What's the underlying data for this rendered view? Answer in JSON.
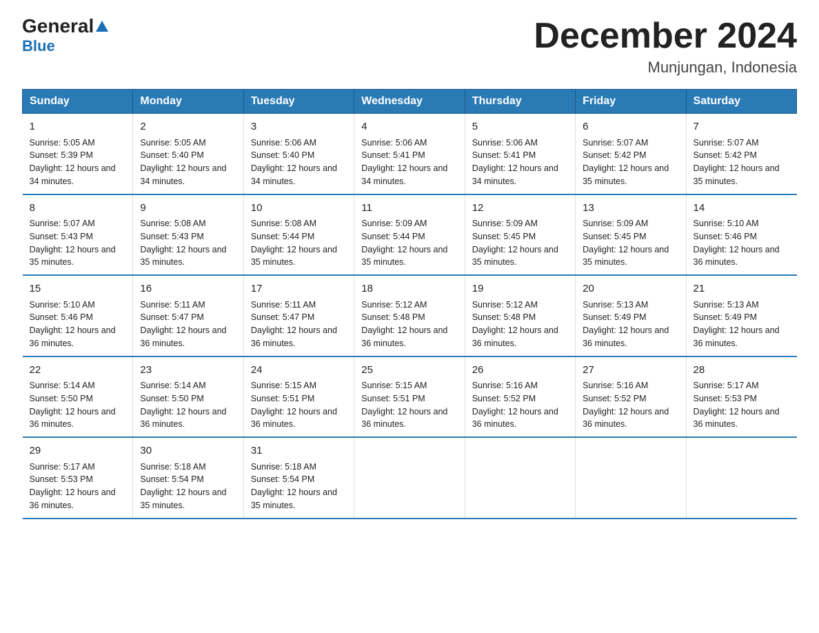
{
  "header": {
    "logo_general": "General",
    "logo_blue": "Blue",
    "title": "December 2024",
    "subtitle": "Munjungan, Indonesia"
  },
  "columns": [
    "Sunday",
    "Monday",
    "Tuesday",
    "Wednesday",
    "Thursday",
    "Friday",
    "Saturday"
  ],
  "weeks": [
    [
      {
        "day": "1",
        "sunrise": "5:05 AM",
        "sunset": "5:39 PM",
        "daylight": "12 hours and 34 minutes."
      },
      {
        "day": "2",
        "sunrise": "5:05 AM",
        "sunset": "5:40 PM",
        "daylight": "12 hours and 34 minutes."
      },
      {
        "day": "3",
        "sunrise": "5:06 AM",
        "sunset": "5:40 PM",
        "daylight": "12 hours and 34 minutes."
      },
      {
        "day": "4",
        "sunrise": "5:06 AM",
        "sunset": "5:41 PM",
        "daylight": "12 hours and 34 minutes."
      },
      {
        "day": "5",
        "sunrise": "5:06 AM",
        "sunset": "5:41 PM",
        "daylight": "12 hours and 34 minutes."
      },
      {
        "day": "6",
        "sunrise": "5:07 AM",
        "sunset": "5:42 PM",
        "daylight": "12 hours and 35 minutes."
      },
      {
        "day": "7",
        "sunrise": "5:07 AM",
        "sunset": "5:42 PM",
        "daylight": "12 hours and 35 minutes."
      }
    ],
    [
      {
        "day": "8",
        "sunrise": "5:07 AM",
        "sunset": "5:43 PM",
        "daylight": "12 hours and 35 minutes."
      },
      {
        "day": "9",
        "sunrise": "5:08 AM",
        "sunset": "5:43 PM",
        "daylight": "12 hours and 35 minutes."
      },
      {
        "day": "10",
        "sunrise": "5:08 AM",
        "sunset": "5:44 PM",
        "daylight": "12 hours and 35 minutes."
      },
      {
        "day": "11",
        "sunrise": "5:09 AM",
        "sunset": "5:44 PM",
        "daylight": "12 hours and 35 minutes."
      },
      {
        "day": "12",
        "sunrise": "5:09 AM",
        "sunset": "5:45 PM",
        "daylight": "12 hours and 35 minutes."
      },
      {
        "day": "13",
        "sunrise": "5:09 AM",
        "sunset": "5:45 PM",
        "daylight": "12 hours and 35 minutes."
      },
      {
        "day": "14",
        "sunrise": "5:10 AM",
        "sunset": "5:46 PM",
        "daylight": "12 hours and 36 minutes."
      }
    ],
    [
      {
        "day": "15",
        "sunrise": "5:10 AM",
        "sunset": "5:46 PM",
        "daylight": "12 hours and 36 minutes."
      },
      {
        "day": "16",
        "sunrise": "5:11 AM",
        "sunset": "5:47 PM",
        "daylight": "12 hours and 36 minutes."
      },
      {
        "day": "17",
        "sunrise": "5:11 AM",
        "sunset": "5:47 PM",
        "daylight": "12 hours and 36 minutes."
      },
      {
        "day": "18",
        "sunrise": "5:12 AM",
        "sunset": "5:48 PM",
        "daylight": "12 hours and 36 minutes."
      },
      {
        "day": "19",
        "sunrise": "5:12 AM",
        "sunset": "5:48 PM",
        "daylight": "12 hours and 36 minutes."
      },
      {
        "day": "20",
        "sunrise": "5:13 AM",
        "sunset": "5:49 PM",
        "daylight": "12 hours and 36 minutes."
      },
      {
        "day": "21",
        "sunrise": "5:13 AM",
        "sunset": "5:49 PM",
        "daylight": "12 hours and 36 minutes."
      }
    ],
    [
      {
        "day": "22",
        "sunrise": "5:14 AM",
        "sunset": "5:50 PM",
        "daylight": "12 hours and 36 minutes."
      },
      {
        "day": "23",
        "sunrise": "5:14 AM",
        "sunset": "5:50 PM",
        "daylight": "12 hours and 36 minutes."
      },
      {
        "day": "24",
        "sunrise": "5:15 AM",
        "sunset": "5:51 PM",
        "daylight": "12 hours and 36 minutes."
      },
      {
        "day": "25",
        "sunrise": "5:15 AM",
        "sunset": "5:51 PM",
        "daylight": "12 hours and 36 minutes."
      },
      {
        "day": "26",
        "sunrise": "5:16 AM",
        "sunset": "5:52 PM",
        "daylight": "12 hours and 36 minutes."
      },
      {
        "day": "27",
        "sunrise": "5:16 AM",
        "sunset": "5:52 PM",
        "daylight": "12 hours and 36 minutes."
      },
      {
        "day": "28",
        "sunrise": "5:17 AM",
        "sunset": "5:53 PM",
        "daylight": "12 hours and 36 minutes."
      }
    ],
    [
      {
        "day": "29",
        "sunrise": "5:17 AM",
        "sunset": "5:53 PM",
        "daylight": "12 hours and 36 minutes."
      },
      {
        "day": "30",
        "sunrise": "5:18 AM",
        "sunset": "5:54 PM",
        "daylight": "12 hours and 35 minutes."
      },
      {
        "day": "31",
        "sunrise": "5:18 AM",
        "sunset": "5:54 PM",
        "daylight": "12 hours and 35 minutes."
      },
      null,
      null,
      null,
      null
    ]
  ]
}
